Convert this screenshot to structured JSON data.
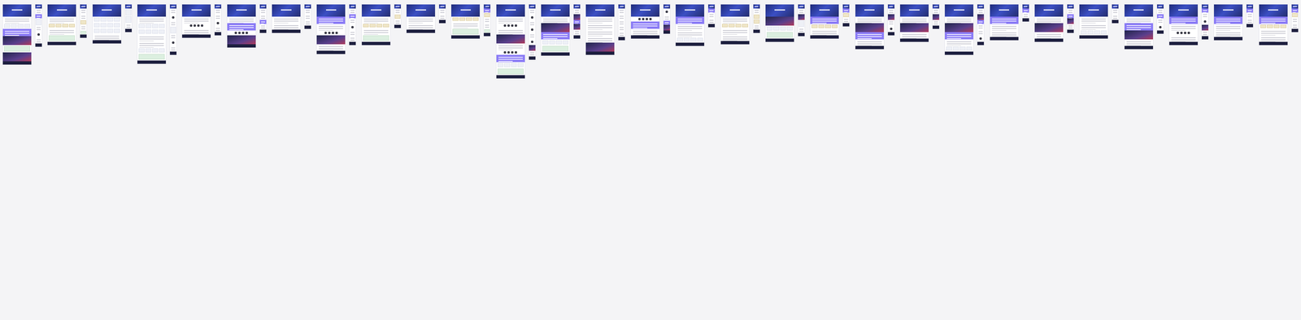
{
  "frames": [
    {
      "sections": [
        "hero",
        "text",
        "cards",
        "band",
        "photo",
        "map",
        "photo",
        "footer"
      ],
      "mobile_sections": [
        "hero",
        "text",
        "band",
        "cards",
        "text",
        "avatars",
        "text",
        "footer"
      ]
    },
    {
      "sections": [
        "hero",
        "text",
        "gold",
        "text",
        "map",
        "footer"
      ],
      "mobile_sections": [
        "hero",
        "text",
        "text",
        "gold",
        "text",
        "map",
        "footer"
      ]
    },
    {
      "sections": [
        "hero",
        "cards",
        "cards",
        "cards",
        "text",
        "footer"
      ],
      "mobile_sections": [
        "hero",
        "cards",
        "cards",
        "text",
        "footer"
      ]
    },
    {
      "sections": [
        "hero",
        "text",
        "cards",
        "cards",
        "text",
        "text",
        "cards",
        "map",
        "footer"
      ],
      "mobile_sections": [
        "hero",
        "text",
        "avatars",
        "text",
        "cards",
        "text",
        "avatars",
        "text",
        "footer"
      ]
    },
    {
      "sections": [
        "hero",
        "text",
        "avatars",
        "text",
        "footer"
      ],
      "mobile_sections": [
        "hero",
        "text",
        "text",
        "avatars",
        "text",
        "footer"
      ]
    },
    {
      "sections": [
        "hero",
        "text",
        "band",
        "avatars",
        "photo",
        "footer"
      ],
      "mobile_sections": [
        "hero",
        "text",
        "text",
        "band",
        "text",
        "footer"
      ]
    },
    {
      "sections": [
        "hero",
        "text",
        "text",
        "footer"
      ],
      "mobile_sections": [
        "hero",
        "text",
        "text",
        "text",
        "footer"
      ]
    },
    {
      "sections": [
        "hero",
        "band",
        "text",
        "avatars",
        "photo",
        "text",
        "footer"
      ],
      "mobile_sections": [
        "hero",
        "text",
        "band",
        "text",
        "avatars",
        "text",
        "text",
        "footer"
      ]
    },
    {
      "sections": [
        "hero",
        "text",
        "gold",
        "text",
        "map",
        "footer"
      ],
      "mobile_sections": [
        "hero",
        "text",
        "gold",
        "text",
        "footer"
      ]
    },
    {
      "sections": [
        "hero",
        "text",
        "text",
        "footer"
      ],
      "mobile_sections": [
        "hero",
        "text",
        "text",
        "footer"
      ]
    },
    {
      "sections": [
        "hero",
        "gold",
        "text",
        "map",
        "footer"
      ],
      "mobile_sections": [
        "hero",
        "band",
        "gold",
        "text",
        "text",
        "map",
        "footer"
      ]
    },
    {
      "sections": [
        "hero",
        "text",
        "avatars",
        "text",
        "photo",
        "text",
        "avatars",
        "band",
        "cards",
        "map",
        "footer"
      ],
      "mobile_sections": [
        "hero",
        "text",
        "avatars",
        "text",
        "avatars",
        "text",
        "avatars",
        "photo",
        "text",
        "footer"
      ]
    },
    {
      "sections": [
        "hero",
        "text",
        "photo",
        "band",
        "cards",
        "map",
        "footer"
      ],
      "mobile_sections": [
        "hero",
        "text",
        "photo",
        "band",
        "photo",
        "text",
        "footer"
      ]
    },
    {
      "sections": [
        "hero",
        "text",
        "text",
        "text",
        "text",
        "photo",
        "footer"
      ],
      "mobile_sections": [
        "hero",
        "text",
        "text",
        "text",
        "text",
        "text",
        "footer"
      ]
    },
    {
      "sections": [
        "hero",
        "avatars",
        "band",
        "text",
        "footer"
      ],
      "mobile_sections": [
        "hero",
        "avatars",
        "text",
        "band",
        "photo",
        "footer"
      ]
    },
    {
      "sections": [
        "hero",
        "band",
        "text",
        "text",
        "cards",
        "footer"
      ],
      "mobile_sections": [
        "hero",
        "band",
        "text",
        "text",
        "footer"
      ]
    },
    {
      "sections": [
        "hero",
        "text",
        "gold",
        "text",
        "text",
        "footer"
      ],
      "mobile_sections": [
        "hero",
        "text",
        "gold",
        "gold",
        "text",
        "footer"
      ]
    },
    {
      "sections": [
        "hero",
        "photo",
        "cards",
        "map",
        "footer"
      ],
      "mobile_sections": [
        "hero",
        "text",
        "photo",
        "cards",
        "text",
        "footer"
      ]
    },
    {
      "sections": [
        "hero",
        "band",
        "gold",
        "text",
        "footer"
      ],
      "mobile_sections": [
        "hero",
        "band",
        "gold",
        "text",
        "footer"
      ]
    },
    {
      "sections": [
        "hero",
        "text",
        "photo",
        "band",
        "text",
        "footer"
      ],
      "mobile_sections": [
        "hero",
        "text",
        "photo",
        "text",
        "avatars",
        "footer"
      ]
    },
    {
      "sections": [
        "hero",
        "text",
        "photo",
        "text",
        "footer"
      ],
      "mobile_sections": [
        "hero",
        "text",
        "photo",
        "text",
        "footer"
      ]
    },
    {
      "sections": [
        "hero",
        "text",
        "photo",
        "band",
        "text",
        "cards",
        "footer"
      ],
      "mobile_sections": [
        "hero",
        "text",
        "photo",
        "band",
        "text",
        "text",
        "avatars",
        "footer"
      ]
    },
    {
      "sections": [
        "hero",
        "band",
        "text",
        "text",
        "footer"
      ],
      "mobile_sections": [
        "hero",
        "band",
        "text",
        "footer"
      ]
    },
    {
      "sections": [
        "hero",
        "text",
        "photo",
        "text",
        "footer"
      ],
      "mobile_sections": [
        "hero",
        "text",
        "band",
        "photo",
        "text",
        "footer"
      ]
    },
    {
      "sections": [
        "hero",
        "text",
        "text",
        "cards",
        "footer"
      ],
      "mobile_sections": [
        "hero",
        "text",
        "text",
        "footer"
      ]
    },
    {
      "sections": [
        "hero",
        "text",
        "band",
        "photo",
        "text",
        "footer"
      ],
      "mobile_sections": [
        "hero",
        "text",
        "band",
        "text",
        "avatars",
        "footer"
      ]
    },
    {
      "sections": [
        "hero",
        "band",
        "text",
        "avatars",
        "text",
        "footer"
      ],
      "mobile_sections": [
        "hero",
        "band",
        "text",
        "avatars",
        "photo",
        "text",
        "footer"
      ]
    },
    {
      "sections": [
        "hero",
        "band",
        "text",
        "text",
        "footer"
      ],
      "mobile_sections": [
        "hero",
        "band",
        "text",
        "text",
        "footer"
      ]
    },
    {
      "sections": [
        "hero",
        "band",
        "gold",
        "text",
        "text",
        "footer"
      ],
      "mobile_sections": [
        "hero",
        "band",
        "gold",
        "text",
        "text",
        "footer"
      ]
    }
  ]
}
